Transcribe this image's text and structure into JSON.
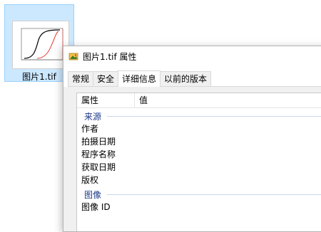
{
  "desktop": {
    "file_label": "图片1.tif"
  },
  "dialog": {
    "title": "图片1.tif 属性",
    "tabs": [
      {
        "label": "常规"
      },
      {
        "label": "安全"
      },
      {
        "label": "详细信息"
      },
      {
        "label": "以前的版本"
      }
    ],
    "active_tab": "详细信息",
    "columns": {
      "name": "属性",
      "value": "值"
    },
    "groups": {
      "source": {
        "label": "来源",
        "rows": [
          "作者",
          "拍摄日期",
          "程序名称",
          "获取日期",
          "版权"
        ]
      },
      "image": {
        "label": "图像",
        "rows": [
          "图像 ID"
        ]
      }
    }
  },
  "colors": {
    "selection_bg": "#cce8ff",
    "group_text": "#1e3a8a",
    "curve_black": "#000000",
    "curve_red": "#e53935"
  }
}
